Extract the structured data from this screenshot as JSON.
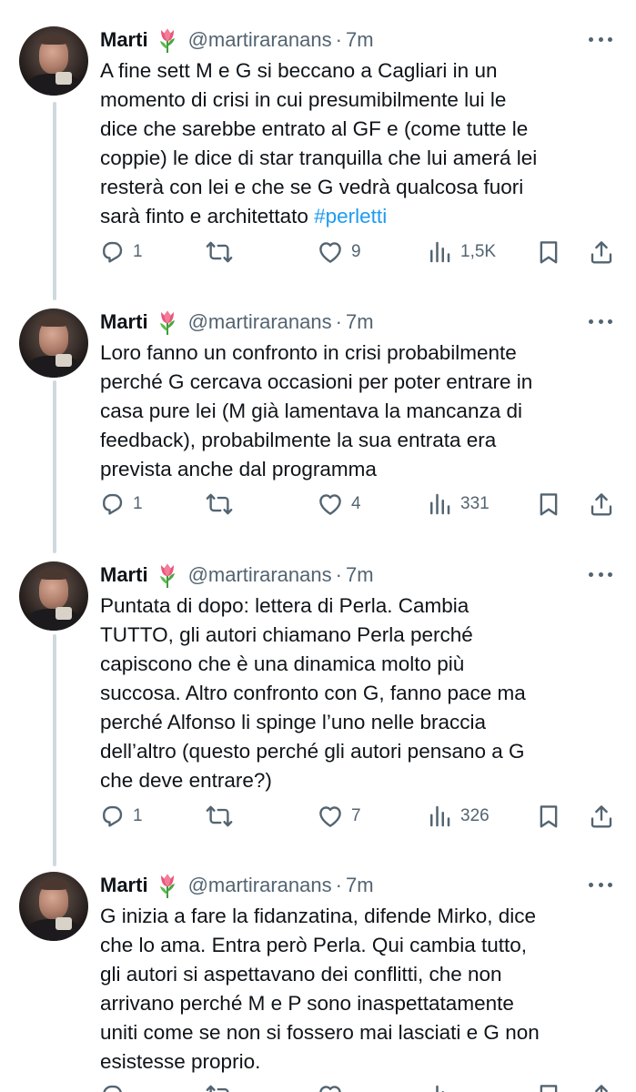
{
  "author": {
    "name": "Marti",
    "handle": "@martiraranans",
    "time": "7m"
  },
  "icons": {
    "flower": "tulip-emoji",
    "reply": "reply-icon",
    "retweet": "retweet-icon",
    "like": "like-icon",
    "views": "views-icon",
    "bookmark": "bookmark-icon",
    "share": "share-icon",
    "more": "more-icon"
  },
  "colors": {
    "link": "#1d9bf0",
    "muted": "#536471",
    "text": "#0f1419"
  },
  "tweets": [
    {
      "text": "A fine sett M e G si beccano a Cagliari in un\nmomento di crisi in cui presumibilmente lui le\ndice che sarebbe entrato al GF e (come tutte le\ncoppie) le dice di star tranquilla che lui amerá lei\nresterà con lei e che se G vedrà qualcosa fuori\nsarà finto e architettato ",
      "hashtag": "#perletti",
      "replies": "1",
      "likes": "9",
      "views": "1,5K"
    },
    {
      "text": "Loro fanno un confronto in crisi probabilmente\nperché G cercava occasioni per poter entrare in\ncasa pure lei (M già lamentava la mancanza di\nfeedback), probabilmente la sua entrata era\nprevista anche dal programma",
      "hashtag": "",
      "replies": "1",
      "likes": "4",
      "views": "331"
    },
    {
      "text": "Puntata di dopo: lettera di Perla. Cambia\nTUTTO, gli autori chiamano Perla perché\ncapiscono che è una dinamica molto più\nsuccosa. Altro confronto con G, fanno pace ma\nperché Alfonso li spinge l’uno nelle braccia\ndell’altro (questo perché gli autori pensano a G\nche deve entrare?)",
      "hashtag": "",
      "replies": "1",
      "likes": "7",
      "views": "326"
    },
    {
      "text": "G inizia a fare la fidanzatina, difende Mirko, dice\nche lo ama. Entra però Perla. Qui cambia tutto,\ngli autori si aspettavano dei conflitti, che non\narrivano perché M e P sono inaspettatamente\nuniti come se non si fossero mai lasciati e G non\nesistesse proprio.",
      "hashtag": "",
      "replies": "",
      "likes": "",
      "views": ""
    }
  ]
}
